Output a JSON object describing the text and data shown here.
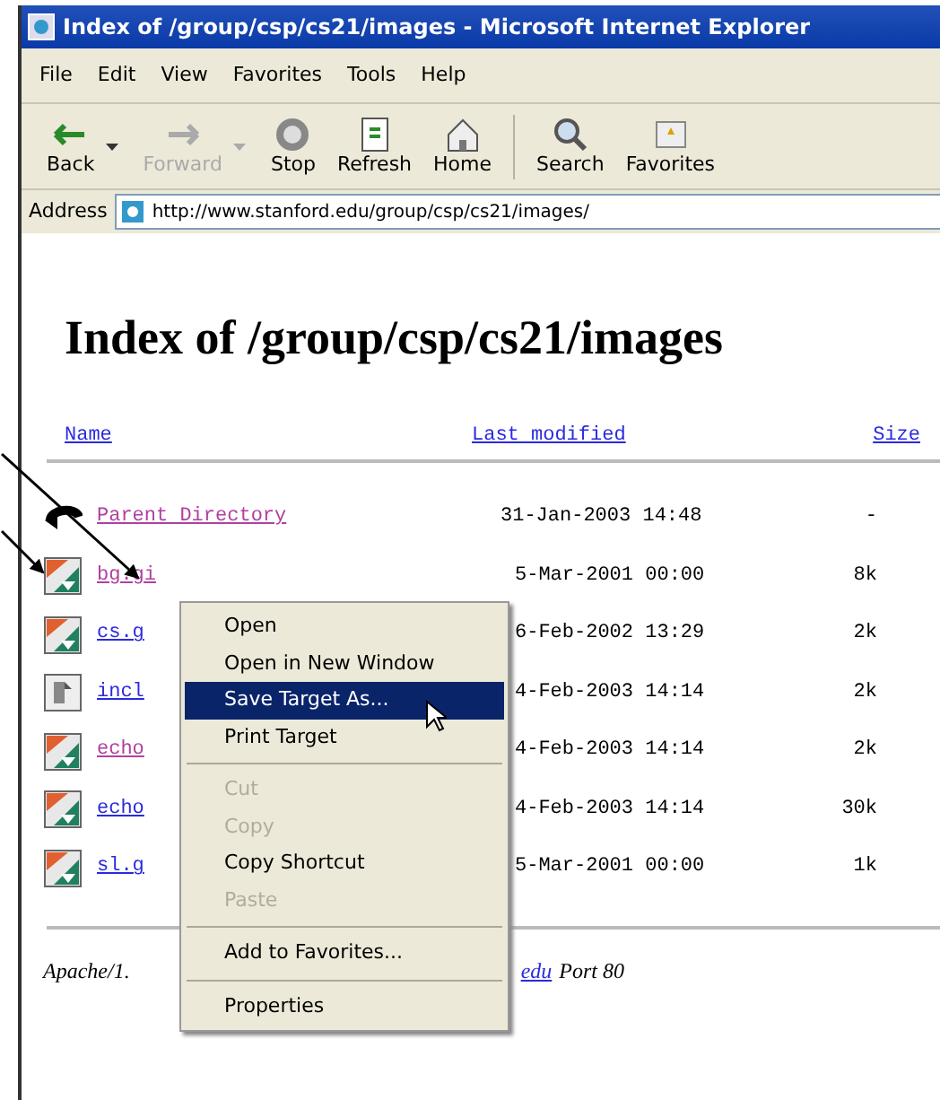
{
  "window": {
    "title": "Index of /group/csp/cs21/images - Microsoft Internet Explorer"
  },
  "menu_bar": [
    "File",
    "Edit",
    "View",
    "Favorites",
    "Tools",
    "Help"
  ],
  "toolbar": [
    {
      "label": "Back",
      "kind": "back",
      "disabled": false,
      "dropdown": true
    },
    {
      "label": "Forward",
      "kind": "forward",
      "disabled": true,
      "dropdown": true
    },
    {
      "label": "Stop",
      "kind": "stop",
      "disabled": false,
      "dropdown": false
    },
    {
      "label": "Refresh",
      "kind": "refresh",
      "disabled": false,
      "dropdown": false
    },
    {
      "label": "Home",
      "kind": "home",
      "disabled": false,
      "dropdown": false
    },
    {
      "label": "Search",
      "kind": "search",
      "disabled": false,
      "dropdown": false
    },
    {
      "label": "Favorites",
      "kind": "favorites",
      "disabled": false,
      "dropdown": false
    }
  ],
  "address_bar": {
    "label": "Address",
    "value": "http://www.stanford.edu/group/csp/cs21/images/"
  },
  "page": {
    "heading": "Index of /group/csp/cs21/images",
    "columns": [
      "Name",
      "Last modified",
      "Size"
    ],
    "rows": [
      {
        "kind": "parent",
        "name": "Parent Directory",
        "visited": true,
        "modified": "31-Jan-2003 14:48",
        "size": "-"
      },
      {
        "kind": "image",
        "name": "bg.gi",
        "visited": true,
        "modified": "5-Mar-2001 00:00",
        "size": "8k"
      },
      {
        "kind": "image",
        "name": "cs.g",
        "visited": false,
        "modified": "6-Feb-2002 13:29",
        "size": "2k"
      },
      {
        "kind": "text",
        "name": "incl",
        "visited": false,
        "modified": "4-Feb-2003 14:14",
        "size": "2k"
      },
      {
        "kind": "image",
        "name": "echo",
        "visited": true,
        "modified": "4-Feb-2003 14:14",
        "size": "2k"
      },
      {
        "kind": "image",
        "name": "echo",
        "visited": false,
        "modified": "4-Feb-2003 14:14",
        "size": "30k"
      },
      {
        "kind": "image",
        "name": "sl.g",
        "visited": false,
        "modified": "5-Mar-2001 00:00",
        "size": "1k"
      }
    ],
    "footer": {
      "text": "Apache/1.",
      "link": "edu",
      "after": "Port 80"
    }
  },
  "context_menu": {
    "items": [
      {
        "kind": "item",
        "label": "Open",
        "disabled": false,
        "selected": false
      },
      {
        "kind": "item",
        "label": "Open in New Window",
        "disabled": false,
        "selected": false
      },
      {
        "kind": "item",
        "label": "Save Target As...",
        "disabled": false,
        "selected": true
      },
      {
        "kind": "item",
        "label": "Print Target",
        "disabled": false,
        "selected": false
      },
      {
        "kind": "separator"
      },
      {
        "kind": "item",
        "label": "Cut",
        "disabled": true,
        "selected": false
      },
      {
        "kind": "item",
        "label": "Copy",
        "disabled": true,
        "selected": false
      },
      {
        "kind": "item",
        "label": "Copy Shortcut",
        "disabled": false,
        "selected": false
      },
      {
        "kind": "item",
        "label": "Paste",
        "disabled": true,
        "selected": false
      },
      {
        "kind": "separator"
      },
      {
        "kind": "item",
        "label": "Add to Favorites...",
        "disabled": false,
        "selected": false
      },
      {
        "kind": "separator"
      },
      {
        "kind": "item",
        "label": "Properties",
        "disabled": false,
        "selected": false
      }
    ]
  }
}
